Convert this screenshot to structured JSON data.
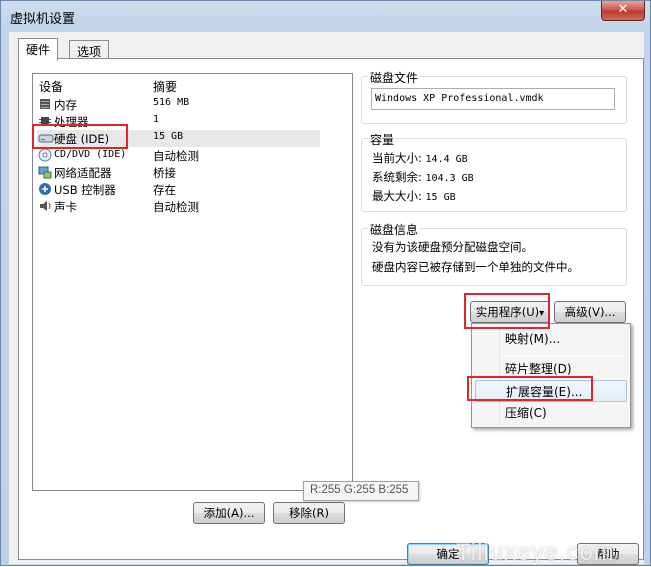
{
  "window": {
    "title": "虚拟机设置"
  },
  "tabs": [
    {
      "label": "硬件",
      "active": true
    },
    {
      "label": "选项",
      "active": false
    }
  ],
  "device_list": {
    "headers": {
      "device": "设备",
      "summary": "摘要"
    },
    "rows": [
      {
        "name": "内存",
        "summary": "516 MB",
        "icon": "memory-icon"
      },
      {
        "name": "处理器",
        "summary": "1",
        "icon": "processor-icon"
      },
      {
        "name": "硬盘 (IDE)",
        "summary": "15 GB",
        "icon": "hard-disk-icon",
        "selected": true
      },
      {
        "name": "CD/DVD (IDE)",
        "summary": "自动检测",
        "icon": "cd-dvd-icon"
      },
      {
        "name": "网络适配器",
        "summary": "桥接",
        "icon": "network-adapter-icon"
      },
      {
        "name": "USB 控制器",
        "summary": "存在",
        "icon": "usb-controller-icon"
      },
      {
        "name": "声卡",
        "summary": "自动检测",
        "icon": "sound-card-icon"
      }
    ]
  },
  "disk_file": {
    "label": "磁盘文件",
    "value": "Windows XP Professional.vmdk"
  },
  "capacity": {
    "label": "容量",
    "current_label": "当前大小:",
    "current_value": "14.4 GB",
    "free_label": "系统剩余:",
    "free_value": "104.3 GB",
    "max_label": "最大大小:",
    "max_value": "15 GB"
  },
  "disk_info": {
    "label": "磁盘信息",
    "line1": "没有为该硬盘预分配磁盘空间。",
    "line2": "硬盘内容已被存储到一个单独的文件中。"
  },
  "buttons": {
    "utilities": "实用程序(U)",
    "utilities_arrow": "▾",
    "advanced": "高级(V)...",
    "add": "添加(A)...",
    "remove": "移除(R)",
    "ok": "确定",
    "help": "帮助"
  },
  "utilities_menu": [
    {
      "label": "映射(M)..."
    },
    {
      "label": "碎片整理(D)"
    },
    {
      "label": "扩展容量(E)...",
      "hover": true
    },
    {
      "label": "压缩(C)"
    }
  ],
  "tooltip": "R:255 G:255 B:255",
  "watermark": "Tiliuxeye.com",
  "colors": {
    "highlight": "#e0262c",
    "titlebar": "#c3d5ea",
    "close": "#c75050"
  }
}
